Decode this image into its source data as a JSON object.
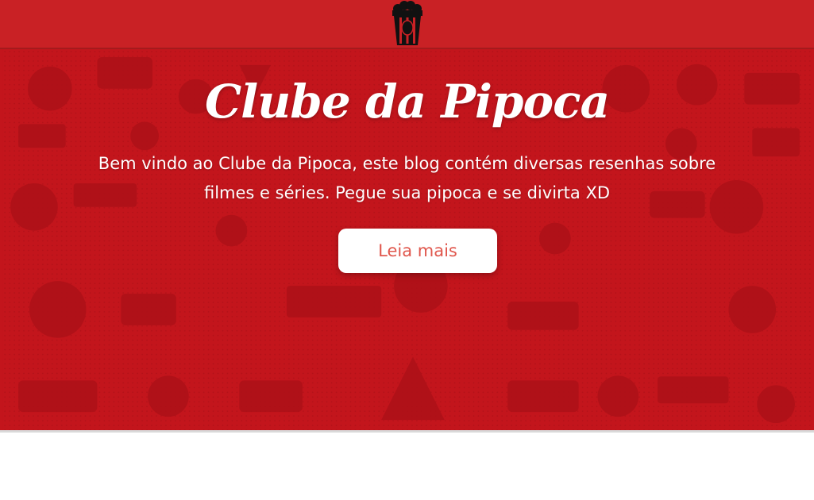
{
  "header": {
    "logo_icon": "popcorn-bucket-icon",
    "background_color": "#c92125"
  },
  "hero": {
    "title": "Clube da Pipoca",
    "description": "Bem vindo ao Clube da Pipoca, este blog contém diversas resenhas sobre filmes e séries. Pegue sua pipoca e se divirta XD",
    "button_label": "Leia mais",
    "background_color": "#c3151c",
    "button_text_color": "#e0574d"
  }
}
